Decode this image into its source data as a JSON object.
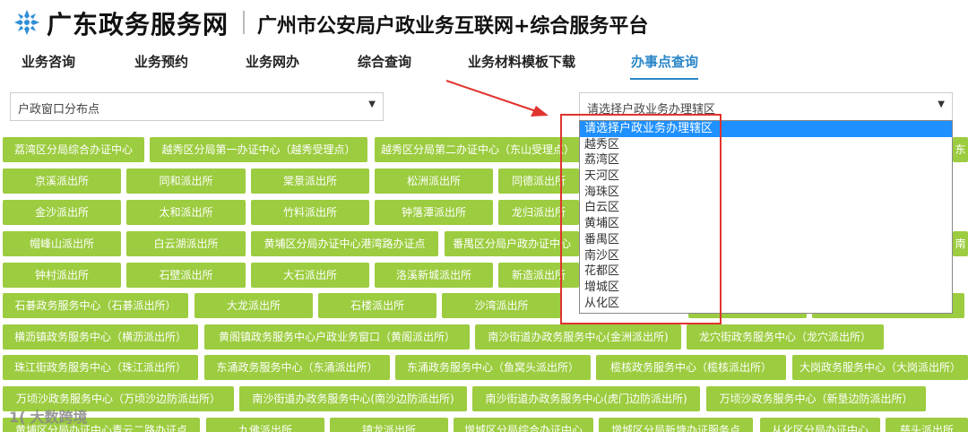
{
  "header": {
    "logo_icon": "snowflake-icon",
    "site_name": "广东政务服务网",
    "platform_name": "广州市公安局户政业务互联网+综合服务平台"
  },
  "nav": {
    "items": [
      "业务咨询",
      "业务预约",
      "业务网办",
      "综合查询",
      "业务材料模板下载",
      "办事点查询"
    ],
    "active": "办事点查询",
    "active_color": "#2a86c8"
  },
  "filters": {
    "left_select": "户政窗口分布点",
    "right_select": "请选择户政业务办理辖区"
  },
  "dropdown": {
    "options": [
      "请选择户政业务办理辖区",
      "越秀区",
      "荔湾区",
      "天河区",
      "海珠区",
      "白云区",
      "黄埔区",
      "番禺区",
      "南沙区",
      "花都区",
      "增城区",
      "从化区"
    ],
    "selected_index": 0
  },
  "offices": [
    "荔湾区分局综合办证中心",
    "越秀区分局第一办证中心（越秀受理点）",
    "越秀区分局第二办证中心（东山受理点）",
    "东",
    "京溪派出所",
    "同和派出所",
    "棠景派出所",
    "松洲派出所",
    "同德派出所",
    "金沙派出所",
    "太和派出所",
    "竹料派出所",
    "钟落潭派出所",
    "龙归派出所",
    "帽峰山派出所",
    "白云湖派出所",
    "黄埔区分局办证中心港湾路办证点",
    "番禺区分局户政办证中心",
    "南",
    "钟村派出所",
    "石壁派出所",
    "大石派出所",
    "洛溪新城派出所",
    "新造派出所",
    "石碁政务服务中心（石碁派出所）",
    "大龙派出所",
    "石楼派出所",
    "沙湾派出所",
    "横沥镇政务服务中心（横沥派出所）",
    "黄阁镇政务服务中心户政业务窗口（黄阁派出所）",
    "南沙街道办政务服务中心(金洲派出所)",
    "龙穴街政务服务中心（龙穴派出所）",
    "珠江街政务服务中心（珠江派出所）",
    "东涌政务服务中心（东涌派出所）",
    "东涌政务服务中心（鱼窝头派出所）",
    "榄核政务服务中心（榄核派出所）",
    "大岗政务服务中心（大岗派出所）",
    "万顷沙政务服务中心（万顷沙边防派出所）",
    "南沙街道办政务服务中心(南沙边防派出所)",
    "南沙街道办政务服务中心(虎门边防派出所)",
    "万顷沙政务服务中心（新垦边防派出所）",
    "黄埔区分局办证中心青云二路办证点",
    "九佛派出所",
    "镇龙派出所",
    "增城区分局综合办证中心",
    "增城区分局新塘办证服务点",
    "从化区分局办证中心",
    "慈头派出所"
  ],
  "watermark": {
    "prefix": "1(",
    "text": "大数跨境"
  },
  "colors": {
    "button_green": "#9ccc3f",
    "highlight_red": "#e0342e",
    "selected_blue": "#1e90ff"
  }
}
